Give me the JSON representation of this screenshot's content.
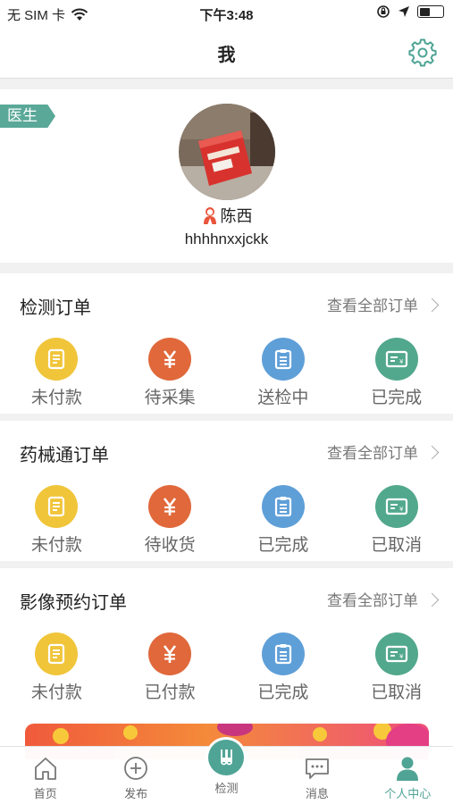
{
  "status_bar": {
    "carrier": "无 SIM 卡",
    "time": "下午3:48"
  },
  "nav": {
    "title": "我"
  },
  "profile": {
    "role_tag": "医生",
    "name": "陈西",
    "account": "hhhhnxxjckk"
  },
  "orders": [
    {
      "title": "检测订单",
      "view_all": "查看全部订单",
      "statuses": [
        {
          "label": "未付款",
          "icon": "unpaid-icon",
          "color": "#f0c53a"
        },
        {
          "label": "待采集",
          "icon": "yen-icon",
          "color": "#e0683a"
        },
        {
          "label": "送检中",
          "icon": "clipboard-icon",
          "color": "#5f9fd8"
        },
        {
          "label": "已完成",
          "icon": "card-icon",
          "color": "#52a88c"
        }
      ]
    },
    {
      "title": "药械通订单",
      "view_all": "查看全部订单",
      "statuses": [
        {
          "label": "未付款",
          "icon": "unpaid-icon",
          "color": "#f0c53a"
        },
        {
          "label": "待收货",
          "icon": "yen-icon",
          "color": "#e0683a"
        },
        {
          "label": "已完成",
          "icon": "clipboard-icon",
          "color": "#5f9fd8"
        },
        {
          "label": "已取消",
          "icon": "card-icon",
          "color": "#52a88c"
        }
      ]
    },
    {
      "title": "影像预约订单",
      "view_all": "查看全部订单",
      "statuses": [
        {
          "label": "未付款",
          "icon": "unpaid-icon",
          "color": "#f0c53a"
        },
        {
          "label": "已付款",
          "icon": "yen-icon",
          "color": "#e0683a"
        },
        {
          "label": "已完成",
          "icon": "clipboard-icon",
          "color": "#5f9fd8"
        },
        {
          "label": "已取消",
          "icon": "card-icon",
          "color": "#52a88c"
        }
      ]
    }
  ],
  "tabs": [
    {
      "label": "首页",
      "icon": "home-icon"
    },
    {
      "label": "发布",
      "icon": "plus-circle-icon"
    },
    {
      "label": "检测",
      "icon": "test-tubes-icon"
    },
    {
      "label": "消息",
      "icon": "message-icon"
    },
    {
      "label": "个人中心",
      "icon": "person-icon",
      "active": true
    }
  ],
  "colors": {
    "accent": "#4fa495",
    "role_tag": "#5aa898"
  }
}
